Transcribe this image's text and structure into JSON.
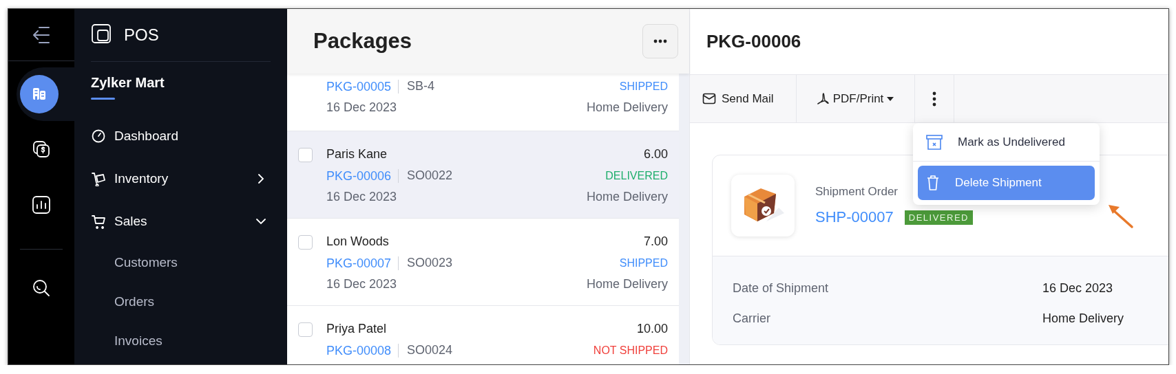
{
  "rail": {
    "items": [
      {
        "selected": true
      },
      {
        "selected": false
      },
      {
        "selected": false
      },
      {
        "selected": false
      }
    ]
  },
  "sidebar": {
    "app_name": "POS",
    "org_name": "Zylker Mart",
    "items": [
      {
        "label": "Dashboard"
      },
      {
        "label": "Inventory",
        "expanded": false
      },
      {
        "label": "Sales",
        "expanded": true,
        "children": [
          {
            "label": "Customers"
          },
          {
            "label": "Orders"
          },
          {
            "label": "Invoices"
          }
        ]
      }
    ]
  },
  "packages": {
    "title": "Packages",
    "rows": [
      {
        "package_no": "PKG-00005",
        "order_no": "SB-4",
        "status": "SHIPPED",
        "color": "#408dfb",
        "date": "16 Dec 2023",
        "carrier": "Home Delivery",
        "selected": false
      },
      {
        "customer": "Paris Kane",
        "amount": "6.00",
        "package_no": "PKG-00006",
        "order_no": "SO0022",
        "status": "DELIVERED",
        "color": "#1fae6c",
        "date": "16 Dec 2023",
        "carrier": "Home Delivery",
        "selected": true,
        "checked": false
      },
      {
        "customer": "Lon Woods",
        "amount": "7.00",
        "package_no": "PKG-00007",
        "order_no": "SO0023",
        "status": "SHIPPED",
        "color": "#408dfb",
        "date": "16 Dec 2023",
        "carrier": "Home Delivery",
        "selected": false,
        "checked": false
      },
      {
        "customer": "Priya Patel",
        "amount": "10.00",
        "package_no": "PKG-00008",
        "order_no": "SO0024",
        "status": "NOT SHIPPED",
        "color": "#f0413c",
        "selected": false,
        "checked": false
      }
    ]
  },
  "detail": {
    "title": "PKG-00006",
    "toolbar": [
      {
        "kind": "mail",
        "label": "Send Mail"
      },
      {
        "kind": "pdf",
        "label": "PDF/Print"
      },
      {
        "kind": "more"
      }
    ],
    "menu": {
      "items": [
        {
          "kind": "undeliver",
          "label": "Mark as Undelivered",
          "selected": false
        },
        {
          "kind": "delete",
          "label": "Delete Shipment",
          "selected": true
        }
      ]
    },
    "shipment": {
      "label": "Shipment Order",
      "number": "SHP-00007",
      "status": "DELIVERED"
    },
    "fields": [
      {
        "label": "Date of Shipment",
        "value": "16 Dec 2023"
      },
      {
        "label": "Carrier",
        "value": "Home Delivery"
      }
    ]
  }
}
